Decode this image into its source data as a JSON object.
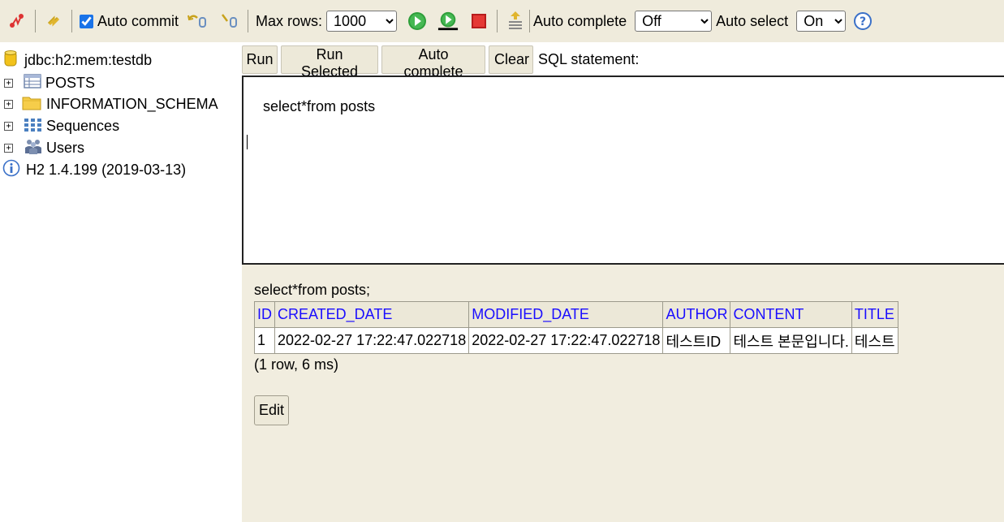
{
  "toolbar": {
    "auto_commit_label": "Auto commit",
    "auto_commit_checked": true,
    "max_rows_label": "Max rows:",
    "max_rows_value": "1000",
    "auto_complete_label": "Auto complete",
    "auto_complete_value": "Off",
    "auto_select_label": "Auto select",
    "auto_select_value": "On"
  },
  "tree": {
    "connection": "jdbc:h2:mem:testdb",
    "items": [
      {
        "label": "POSTS",
        "icon": "table-icon"
      },
      {
        "label": "INFORMATION_SCHEMA",
        "icon": "folder-icon"
      },
      {
        "label": "Sequences",
        "icon": "sequences-icon"
      },
      {
        "label": "Users",
        "icon": "users-icon"
      }
    ],
    "version": "H2 1.4.199 (2019-03-13)"
  },
  "query": {
    "buttons": {
      "run": "Run",
      "run_selected": "Run Selected",
      "auto_complete": "Auto complete",
      "clear": "Clear"
    },
    "sql_label": "SQL statement:",
    "sql_text": "select*from posts"
  },
  "result": {
    "statement": "select*from posts;",
    "columns": [
      "ID",
      "CREATED_DATE",
      "MODIFIED_DATE",
      "AUTHOR",
      "CONTENT",
      "TITLE"
    ],
    "rows": [
      [
        "1",
        "2022-02-27 17:22:47.022718",
        "2022-02-27 17:22:47.022718",
        "테스트ID",
        "테스트 본문입니다.",
        "테스트"
      ]
    ],
    "meta": "(1 row, 6 ms)",
    "edit_label": "Edit"
  },
  "colors": {
    "toolbar_bg": "#efebdc",
    "panel_bg": "#f1eddf",
    "header_link": "#1a0dff",
    "run_green": "#2e9e3a",
    "stop_red": "#d42020"
  }
}
